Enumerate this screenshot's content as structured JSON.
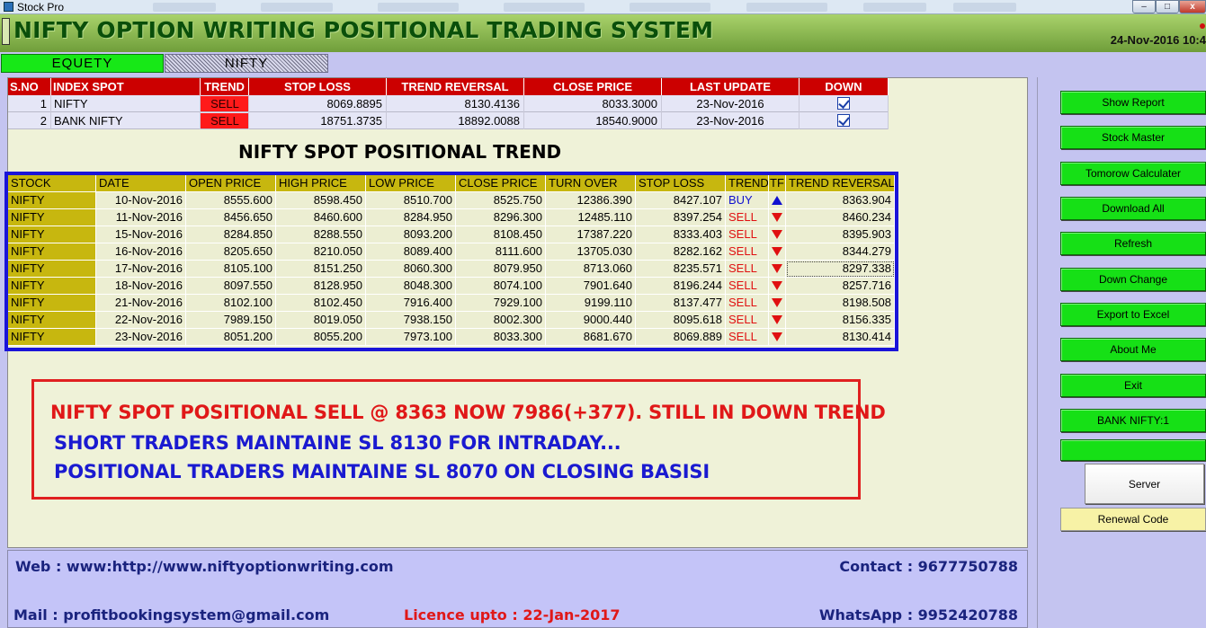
{
  "window": {
    "title": "Stock Pro",
    "buttons": {
      "minimize": "–",
      "maximize": "□",
      "close": "x"
    }
  },
  "header": {
    "title": "NIFTY OPTION WRITING POSITIONAL TRADING SYSTEM",
    "datetime": "24-Nov-2016 10:4"
  },
  "tabs": [
    {
      "label": "EQUETY",
      "active": true
    },
    {
      "label": "NIFTY",
      "active": false
    }
  ],
  "summary": {
    "headers": [
      "S.NO",
      "INDEX SPOT",
      "TREND",
      "STOP LOSS",
      "TREND REVERSAL",
      "CLOSE PRICE",
      "LAST UPDATE",
      "DOWN"
    ],
    "rows": [
      {
        "sno": "1",
        "index": "NIFTY",
        "trend": "SELL",
        "stop_loss": "8069.8895",
        "trend_reversal": "8130.4136",
        "close_price": "8033.3000",
        "last_update": "23-Nov-2016",
        "down": true
      },
      {
        "sno": "2",
        "index": "BANK NIFTY",
        "trend": "SELL",
        "stop_loss": "18751.3735",
        "trend_reversal": "18892.0088",
        "close_price": "18540.9000",
        "last_update": "23-Nov-2016",
        "down": true
      }
    ]
  },
  "section_title": "NIFTY SPOT POSITIONAL TREND",
  "trend_table": {
    "headers": [
      "STOCK",
      "DATE",
      "OPEN PRICE",
      "HIGH PRICE",
      "LOW PRICE",
      "CLOSE PRICE",
      "TURN OVER",
      "STOP LOSS",
      "TREND",
      "TF",
      "TREND REVERSAL"
    ],
    "rows": [
      {
        "stock": "NIFTY",
        "date": "10-Nov-2016",
        "open": "8555.600",
        "high": "8598.450",
        "low": "8510.700",
        "close": "8525.750",
        "turnover": "12386.390",
        "stop_loss": "8427.107",
        "trend": "BUY",
        "arrow": "up",
        "reversal": "8363.904"
      },
      {
        "stock": "NIFTY",
        "date": "11-Nov-2016",
        "open": "8456.650",
        "high": "8460.600",
        "low": "8284.950",
        "close": "8296.300",
        "turnover": "12485.110",
        "stop_loss": "8397.254",
        "trend": "SELL",
        "arrow": "down",
        "reversal": "8460.234"
      },
      {
        "stock": "NIFTY",
        "date": "15-Nov-2016",
        "open": "8284.850",
        "high": "8288.550",
        "low": "8093.200",
        "close": "8108.450",
        "turnover": "17387.220",
        "stop_loss": "8333.403",
        "trend": "SELL",
        "arrow": "down",
        "reversal": "8395.903"
      },
      {
        "stock": "NIFTY",
        "date": "16-Nov-2016",
        "open": "8205.650",
        "high": "8210.050",
        "low": "8089.400",
        "close": "8111.600",
        "turnover": "13705.030",
        "stop_loss": "8282.162",
        "trend": "SELL",
        "arrow": "down",
        "reversal": "8344.279"
      },
      {
        "stock": "NIFTY",
        "date": "17-Nov-2016",
        "open": "8105.100",
        "high": "8151.250",
        "low": "8060.300",
        "close": "8079.950",
        "turnover": "8713.060",
        "stop_loss": "8235.571",
        "trend": "SELL",
        "arrow": "down",
        "reversal": "8297.338"
      },
      {
        "stock": "NIFTY",
        "date": "18-Nov-2016",
        "open": "8097.550",
        "high": "8128.950",
        "low": "8048.300",
        "close": "8074.100",
        "turnover": "7901.640",
        "stop_loss": "8196.244",
        "trend": "SELL",
        "arrow": "down",
        "reversal": "8257.716"
      },
      {
        "stock": "NIFTY",
        "date": "21-Nov-2016",
        "open": "8102.100",
        "high": "8102.450",
        "low": "7916.400",
        "close": "7929.100",
        "turnover": "9199.110",
        "stop_loss": "8137.477",
        "trend": "SELL",
        "arrow": "down",
        "reversal": "8198.508"
      },
      {
        "stock": "NIFTY",
        "date": "22-Nov-2016",
        "open": "7989.150",
        "high": "8019.050",
        "low": "7938.150",
        "close": "8002.300",
        "turnover": "9000.440",
        "stop_loss": "8095.618",
        "trend": "SELL",
        "arrow": "down",
        "reversal": "8156.335"
      },
      {
        "stock": "NIFTY",
        "date": "23-Nov-2016",
        "open": "8051.200",
        "high": "8055.200",
        "low": "7973.100",
        "close": "8033.300",
        "turnover": "8681.670",
        "stop_loss": "8069.889",
        "trend": "SELL",
        "arrow": "down",
        "reversal": "8130.414"
      }
    ]
  },
  "message": {
    "line1": "NIFTY SPOT POSITIONAL SELL @ 8363 NOW 7986(+377). STILL IN DOWN TREND",
    "line2": "SHORT TRADERS MAINTAINE SL 8130 FOR INTRADAY...",
    "line3": "POSITIONAL TRADERS MAINTAINE SL 8070 ON CLOSING BASISI"
  },
  "footer": {
    "web": "Web : www:http://www.niftyoptionwriting.com",
    "contact": "Contact : 9677750788",
    "mail": "Mail : profitbookingsystem@gmail.com",
    "licence": "Licence upto : 22-Jan-2017",
    "whatsapp": "WhatsApp : 9952420788"
  },
  "side_buttons": {
    "show_report": "Show Report",
    "stock_master": "Stock Master",
    "tomorrow_calculator": "Tomorow Calculater",
    "download_all": "Download All",
    "refresh": "Refresh",
    "down_change": "Down Change",
    "export_excel": "Export to Excel",
    "about_me": "About Me",
    "exit": "Exit",
    "bank_nifty": "BANK NIFTY:1",
    "blank": "",
    "server": "Server",
    "renewal_code": "Renewal Code"
  },
  "colors": {
    "accent_green": "#16e016",
    "header_red": "#cc0000",
    "grid_border_blue": "#1a14d8",
    "sell_red": "#e01010",
    "buy_blue": "#1010d0"
  }
}
